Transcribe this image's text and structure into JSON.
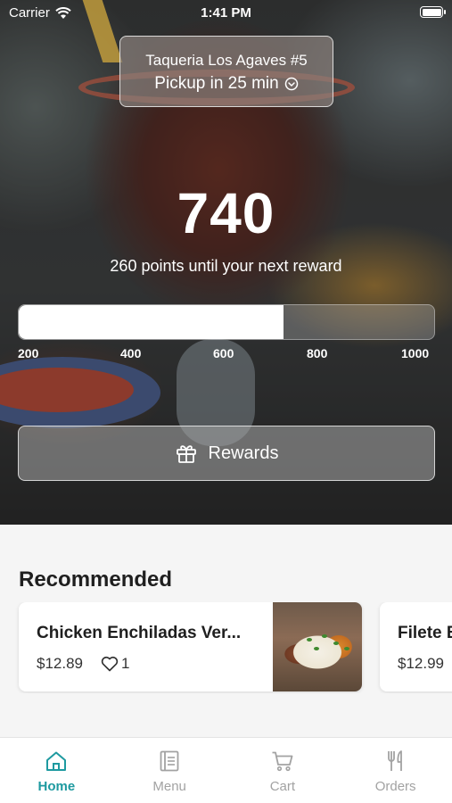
{
  "status_bar": {
    "carrier": "Carrier",
    "time": "1:41 PM"
  },
  "store": {
    "name": "Taqueria Los Agaves #5",
    "pickup": "Pickup in 25 min"
  },
  "loyalty": {
    "points": "740",
    "subtitle": "260 points until your next reward",
    "progress_value": 740,
    "progress_min": 0,
    "progress_max": 1000,
    "ticks": [
      "200",
      "400",
      "600",
      "800",
      "1000"
    ],
    "rewards_label": "Rewards"
  },
  "recommended": {
    "title": "Recommended",
    "items": [
      {
        "name": "Chicken Enchiladas Ver...",
        "price": "$12.89",
        "likes": "1",
        "image_icon": "enchiladas-photo"
      },
      {
        "name": "Filete E",
        "price": "$12.99"
      }
    ]
  },
  "tabbar": {
    "tabs": [
      {
        "label": "Home",
        "icon": "home-icon",
        "active": true
      },
      {
        "label": "Menu",
        "icon": "menu-icon",
        "active": false
      },
      {
        "label": "Cart",
        "icon": "cart-icon",
        "active": false
      },
      {
        "label": "Orders",
        "icon": "utensils-icon",
        "active": false
      }
    ]
  },
  "colors": {
    "accent": "#1e9aa0",
    "inactive": "#a2a2a2"
  }
}
